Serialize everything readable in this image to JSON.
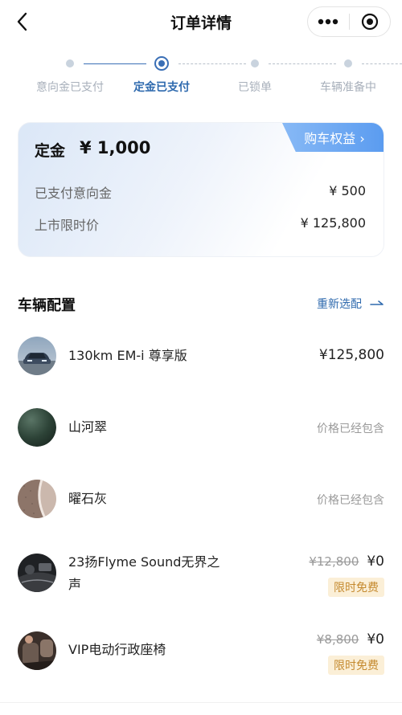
{
  "header": {
    "title": "订单详情",
    "back_icon": "chevron-left-icon",
    "more_icon": "more-dots-icon",
    "close_icon": "target-close-icon"
  },
  "steps": [
    {
      "label": "意向金已支付",
      "state": "done"
    },
    {
      "label": "定金已支付",
      "state": "active"
    },
    {
      "label": "已锁单",
      "state": "pending"
    },
    {
      "label": "车辆准备中",
      "state": "pending"
    }
  ],
  "deposit": {
    "title": "定金",
    "amount": "¥ 1,000",
    "benefits_label": "购车权益 ›",
    "rows": [
      {
        "label": "已支付意向金",
        "value": "¥ 500"
      },
      {
        "label": "上市限时价",
        "value": "¥ 125,800"
      }
    ]
  },
  "config": {
    "title": "车辆配置",
    "reselect_label": "重新选配",
    "items": [
      {
        "name": "130km EM-i 尊享版",
        "price": "¥125,800",
        "thumb": "car"
      },
      {
        "name": "山河翠",
        "included": "价格已经包含",
        "thumb": "paint-green"
      },
      {
        "name": "曜石灰",
        "included": "价格已经包含",
        "thumb": "interior-gray"
      },
      {
        "name_line1": "23扬Flyme Sound无界之",
        "name_line2": "声",
        "old_price": "¥12,800",
        "price": "¥0",
        "tag": "限时免费",
        "thumb": "audio"
      },
      {
        "name": "VIP电动行政座椅",
        "old_price": "¥8,800",
        "price": "¥0",
        "tag": "限时免费",
        "thumb": "seat"
      }
    ]
  },
  "colors": {
    "accent": "#2f6aae",
    "tag_bg": "#fbefd7",
    "tag_text": "#c58a2f"
  }
}
